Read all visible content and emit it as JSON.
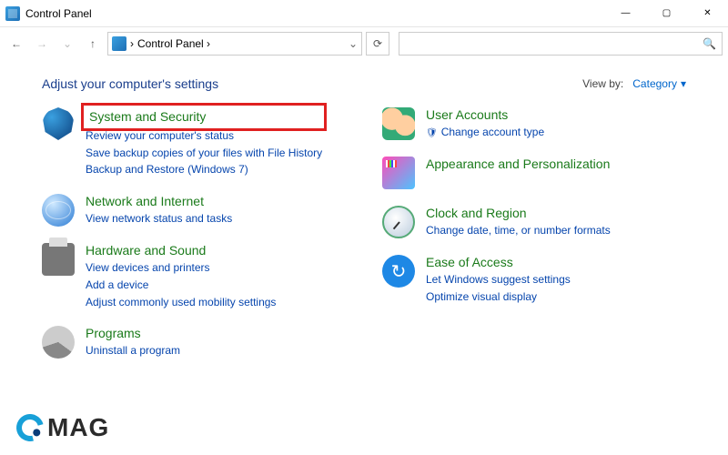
{
  "window": {
    "title": "Control Panel",
    "controls": {
      "min": "—",
      "max": "▢",
      "close": "✕"
    }
  },
  "nav": {
    "back": "←",
    "forward": "→",
    "up": "↑",
    "dropdown": "⌄",
    "refresh": "⟳",
    "breadcrumb": "Control Panel  ›",
    "search_placeholder": "",
    "mag": "🔍"
  },
  "header": {
    "title": "Adjust your computer's settings",
    "viewby_label": "View by:",
    "viewby_value": "Category",
    "caret": "▾"
  },
  "left": [
    {
      "id": "system-security",
      "title": "System and Security",
      "links": [
        "Review your computer's status",
        "Save backup copies of your files with File History",
        "Backup and Restore (Windows 7)"
      ],
      "highlight": true
    },
    {
      "id": "network",
      "title": "Network and Internet",
      "links": [
        "View network status and tasks"
      ]
    },
    {
      "id": "hardware",
      "title": "Hardware and Sound",
      "links": [
        "View devices and printers",
        "Add a device",
        "Adjust commonly used mobility settings"
      ]
    },
    {
      "id": "programs",
      "title": "Programs",
      "links": [
        "Uninstall a program"
      ]
    }
  ],
  "right": [
    {
      "id": "user-accounts",
      "title": "User Accounts",
      "links": [
        "Change account type"
      ],
      "shield": [
        true
      ]
    },
    {
      "id": "appearance",
      "title": "Appearance and Personalization",
      "links": []
    },
    {
      "id": "clock",
      "title": "Clock and Region",
      "links": [
        "Change date, time, or number formats"
      ]
    },
    {
      "id": "ease",
      "title": "Ease of Access",
      "links": [
        "Let Windows suggest settings",
        "Optimize visual display"
      ]
    }
  ],
  "logo": "MAG"
}
